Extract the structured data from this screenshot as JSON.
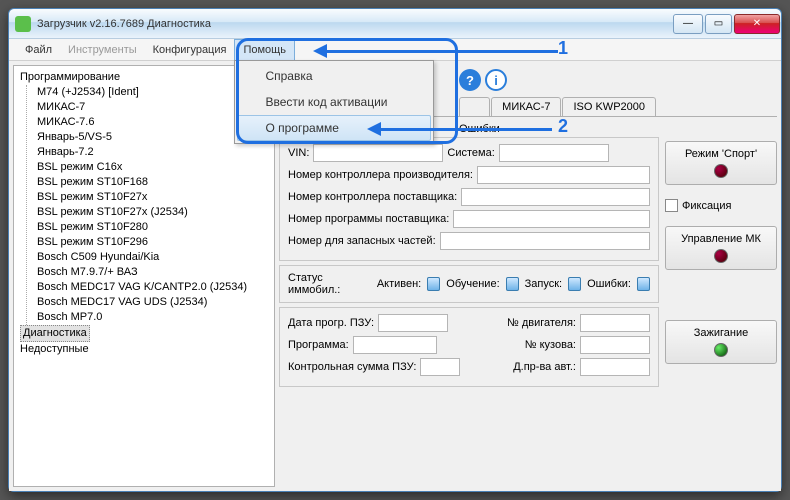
{
  "window": {
    "title": "Загрузчик v2.16.7689 Диагностика"
  },
  "menubar": {
    "file": "Файл",
    "tools": "Инструменты",
    "config": "Конфигурация",
    "help": "Помощь"
  },
  "help_menu": {
    "help": "Справка",
    "enter_code": "Ввести код активации",
    "about": "О программе"
  },
  "tree": {
    "programming": "Программирование",
    "items": [
      "M74 (+J2534) [Ident]",
      "МИКАС-7",
      "МИКАС-7.6",
      "Январь-5/VS-5",
      "Январь-7.2",
      "BSL режим C16x",
      "BSL режим ST10F168",
      "BSL режим ST10F27x",
      "BSL режим ST10F27x (J2534)",
      "BSL режим ST10F280",
      "BSL режим ST10F296",
      "Bosch C509 Hyundai/Kia",
      "Bosch M7.9.7/+ ВАЗ",
      "Bosch MEDC17 VAG K/CANTP2.0 (J2534)",
      "Bosch MEDC17 VAG UDS (J2534)",
      "Bosch MP7.0"
    ],
    "diagnostics": "Диагностика",
    "unavailable": "Недоступные"
  },
  "tabs": {
    "mikas7": "МИКАС-7",
    "isokwp": "ISO KWP2000"
  },
  "subtabs": {
    "errors": "Ошибки"
  },
  "form": {
    "vin": "VIN:",
    "system": "Система:",
    "mfr_ctrl": "Номер контроллера производителя:",
    "supplier_ctrl": "Номер контроллера поставщика:",
    "supplier_prog": "Номер программы поставщика:",
    "spare": "Номер для запасных частей:",
    "immo_status": "Статус иммобил.:",
    "active": "Активен:",
    "learning": "Обучение:",
    "start": "Запуск:",
    "immo_errors": "Ошибки:",
    "rom_date": "Дата прогр. ПЗУ:",
    "program": "Программа:",
    "rom_checksum": "Контрольная сумма ПЗУ:",
    "engine_no": "№ двигателя:",
    "body_no": "№ кузова:",
    "mfr_date": "Д.пр-ва авт.:"
  },
  "side": {
    "sport": "Режим 'Спорт'",
    "fixation": "Фиксация",
    "mk_control": "Управление МК",
    "ignition": "Зажигание"
  },
  "annotations": {
    "one": "1",
    "two": "2"
  }
}
